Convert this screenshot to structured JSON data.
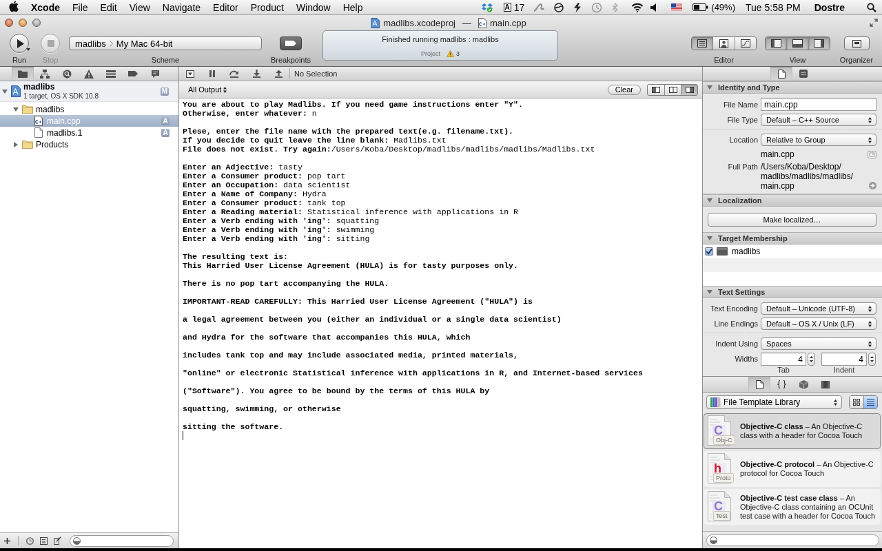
{
  "menu_bar": {
    "app": "Xcode",
    "items": [
      "File",
      "Edit",
      "View",
      "Navigate",
      "Editor",
      "Product",
      "Window",
      "Help"
    ],
    "extra_logo": "A",
    "extra_count": "17",
    "battery": "(49%)",
    "clock": "Tue 5:58 PM",
    "user": "Dostre"
  },
  "window": {
    "project": "madlibs.xcodeproj",
    "separator": "—",
    "document": "main.cpp"
  },
  "toolbar": {
    "run": {
      "label": "Run",
      "disabled": false
    },
    "stop": {
      "label": "Stop",
      "disabled": true
    },
    "scheme": {
      "label": "Scheme",
      "target": "madlibs",
      "destination": "My Mac 64-bit"
    },
    "breakpoints": {
      "label": "Breakpoints"
    },
    "activity": {
      "message": "Finished running madlibs : madlibs",
      "source": "Project",
      "warnings": "3"
    },
    "editor": {
      "label": "Editor",
      "modes": [
        {
          "selected": true
        },
        {
          "selected": false
        },
        {
          "selected": false
        }
      ]
    },
    "view": {
      "label": "View",
      "panels": [
        {
          "on": true
        },
        {
          "on": true
        },
        {
          "on": true
        }
      ]
    },
    "organizer": {
      "label": "Organizer"
    }
  },
  "navigator": {
    "tabs": [
      {
        "selected": true
      },
      {
        "selected": false
      },
      {
        "selected": false
      },
      {
        "selected": false
      },
      {
        "selected": false
      },
      {
        "selected": false
      },
      {
        "selected": false
      }
    ],
    "project": {
      "name": "madlibs",
      "subtitle": "1 target, OS X SDK 10.8",
      "badge": "M",
      "expanded": true
    },
    "tree": [
      {
        "name": "madlibs",
        "kind": "folder",
        "expanded": true,
        "selected": false,
        "children": [
          {
            "name": "main.cpp",
            "kind": "cpp",
            "badge": "A",
            "selected": true
          },
          {
            "name": "madlibs.1",
            "kind": "file",
            "badge": "A",
            "selected": false
          }
        ]
      },
      {
        "name": "Products",
        "kind": "folder",
        "expanded": false,
        "selected": false
      }
    ]
  },
  "debug_bar": {
    "selection": "No Selection"
  },
  "console": {
    "filter": "All Output",
    "clear": "Clear",
    "layouts": [
      {
        "selected": false
      },
      {
        "selected": false
      },
      {
        "selected": true
      }
    ],
    "cursor": true,
    "blocks": [
      [
        {
          "output": "You are about to play Madlibs. If you need game instructions enter \"Y\"."
        },
        {
          "output": "Otherwise, enter whatever: ",
          "input": "n"
        }
      ],
      [
        {
          "output": "Plese, enter the file name with the prepared text(e.g. filename.txt)."
        },
        {
          "output": "If you decide to quit leave the line blank: ",
          "input": "Madlibs.txt"
        },
        {
          "output": "File does not exist. Try again:",
          "input": "/Users/Koba/Desktop/madlibs/madlibs/madlibs/Madlibs.txt"
        }
      ],
      [
        {
          "output": "Enter an Adjective: ",
          "input": "tasty"
        },
        {
          "output": "Enter a Consumer product: ",
          "input": "pop tart"
        },
        {
          "output": "Enter an Occupation: ",
          "input": "data scientist"
        },
        {
          "output": "Enter a Name of Company: ",
          "input": "Hydra"
        },
        {
          "output": "Enter a Consumer product: ",
          "input": "tank top"
        },
        {
          "output": "Enter a Reading material: ",
          "input": "Statistical inference with applications in R"
        },
        {
          "output": "Enter a Verb ending with 'ing': ",
          "input": "squatting"
        },
        {
          "output": "Enter a Verb ending with 'ing': ",
          "input": "swimming"
        },
        {
          "output": "Enter a Verb ending with 'ing': ",
          "input": "sitting"
        }
      ],
      [
        {
          "output": "The resulting text is:"
        },
        {
          "output": "This Harried User License Agreement (HULA) is for tasty purposes only."
        }
      ],
      [
        {
          "output": "There is no pop tart accompanying the HULA."
        }
      ],
      [
        {
          "output": "IMPORTANT-READ CAREFULLY: This Harried User License Agreement (\"HULA\") is"
        }
      ],
      [
        {
          "output": "a legal agreement between you (either an individual or a single data scientist)"
        }
      ],
      [
        {
          "output": "and Hydra for the software that accompanies this HULA, which"
        }
      ],
      [
        {
          "output": "includes tank top and may include associated media, printed materials,"
        }
      ],
      [
        {
          "output": "\"online\" or electronic Statistical inference with applications in R, and Internet-based services"
        }
      ],
      [
        {
          "output": "(\"Software\"). You agree to be bound by the terms of this HULA by"
        }
      ],
      [
        {
          "output": "squatting, swimming, or otherwise"
        }
      ],
      [
        {
          "output": "sitting the software."
        }
      ]
    ]
  },
  "inspector": {
    "tabs": [
      {
        "selected": true
      },
      {
        "selected": false
      }
    ],
    "identity": {
      "title": "Identity and Type",
      "expanded": true,
      "file_name": {
        "label": "File Name",
        "value": "main.cpp"
      },
      "file_type": {
        "label": "File Type",
        "value": "Default – C++ Source"
      },
      "location": {
        "label": "Location",
        "value": "Relative to Group"
      },
      "relative_path": "main.cpp",
      "full_path": {
        "label": "Full Path",
        "lines": [
          "/Users/Koba/Desktop/",
          "madlibs/madlibs/madlibs/",
          "main.cpp"
        ]
      }
    },
    "localization": {
      "title": "Localization",
      "expanded": true,
      "button": "Make localized…"
    },
    "target_membership": {
      "title": "Target Membership",
      "expanded": true,
      "targets": [
        {
          "name": "madlibs",
          "checked": true
        }
      ]
    },
    "text_settings": {
      "title": "Text Settings",
      "expanded": true,
      "encoding": {
        "label": "Text Encoding",
        "value": "Default – Unicode (UTF-8)"
      },
      "line_endings": {
        "label": "Line Endings",
        "value": "Default – OS X / Unix (LF)"
      },
      "indent_using": {
        "label": "Indent Using",
        "value": "Spaces"
      },
      "widths": {
        "label": "Widths",
        "fields": [
          {
            "value": "4",
            "caption": "Tab"
          },
          {
            "value": "4",
            "caption": "Indent"
          }
        ]
      }
    }
  },
  "library": {
    "tabs": [
      {
        "selected": true
      },
      {
        "selected": false
      },
      {
        "selected": false
      },
      {
        "selected": false
      }
    ],
    "source": "File Template Library",
    "view_modes": [
      {
        "selected": false
      },
      {
        "selected": true
      }
    ],
    "items": [
      {
        "text": "**Objective-C class** – An Objective-C class with a header for Cocoa Touch",
        "glyph": "C",
        "color": "#8d76c2",
        "tag": "Obj-C",
        "selected": true
      },
      {
        "text": "**Objective-C protocol** – An Objective-C protocol for Cocoa Touch",
        "glyph": "h",
        "color": "#c8202a",
        "tag": "Proto",
        "selected": false
      },
      {
        "text": "**Objective-C test case class** – An Objective-C class containing an OCUnit test case with a header for Cocoa Touch",
        "glyph": "C",
        "color": "#8d76c2",
        "tag": "Test",
        "selected": false
      }
    ]
  }
}
